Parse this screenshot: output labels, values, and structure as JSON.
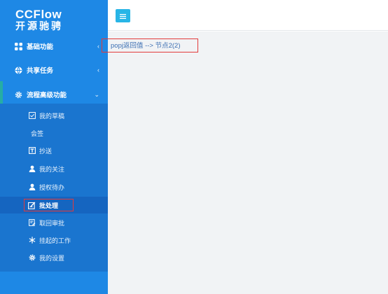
{
  "logo": {
    "line1": "CCFlow",
    "line2": "开源驰骋"
  },
  "menu": {
    "basic": {
      "label": "基础功能",
      "icon": "grid-icon"
    },
    "shared": {
      "label": "共享任务",
      "icon": "globe-icon"
    },
    "advanced": {
      "label": "流程高级功能",
      "icon": "gear-icon"
    }
  },
  "submenu": [
    {
      "label": "我的草稿",
      "icon": "draft-icon"
    },
    {
      "label": "会签",
      "icon": ""
    },
    {
      "label": "抄送",
      "icon": "cc-icon"
    },
    {
      "label": "我的关注",
      "icon": "user-icon"
    },
    {
      "label": "授权待办",
      "icon": "user-icon"
    },
    {
      "label": "批处理",
      "icon": "batch-icon",
      "active": true
    },
    {
      "label": "取回审批",
      "icon": "retrieve-icon"
    },
    {
      "label": "挂起的工作",
      "icon": "snowflake-icon"
    },
    {
      "label": "我的设置",
      "icon": "settings-icon"
    }
  ],
  "breadcrumb": "popj返回值 --> 节点2(2)",
  "colors": {
    "sidebar": "#1e88e5",
    "toggle": "#28b5e6",
    "highlight": "#e23b3b"
  }
}
